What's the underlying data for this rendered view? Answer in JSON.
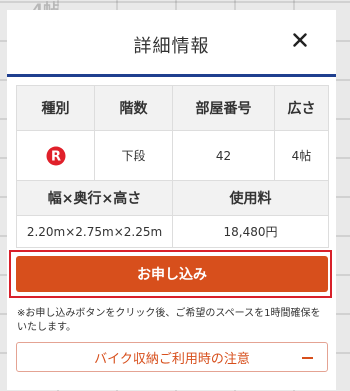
{
  "modal": {
    "title": "詳細情報",
    "close_icon": "close-icon"
  },
  "details_table": {
    "row1_headers": [
      "種別",
      "階数",
      "部屋番号",
      "広さ"
    ],
    "row1_values": {
      "type_icon": "red-circle-r-icon",
      "floor": "下段",
      "room_number": "42",
      "size": "4帖"
    },
    "row2_headers": [
      "幅×奥行×高さ",
      "使用料"
    ],
    "row2_values": {
      "dimensions": "2.20m×2.75m×2.25m",
      "fee": "18,480円"
    }
  },
  "apply_button": {
    "label": "お申し込み",
    "highlight_color": "#d8202a"
  },
  "note": "※お申し込みボタンをクリック後、ご希望のスペースを1時間確保をいたします。",
  "caution_button": {
    "label": "バイク収納ご利用時の注意",
    "icon": "minus-icon"
  },
  "colors": {
    "accent": "#d74f1c",
    "header_rule": "#1f3f8f",
    "type_icon": "#e0202a"
  },
  "background_labels": [
    "4帖"
  ]
}
